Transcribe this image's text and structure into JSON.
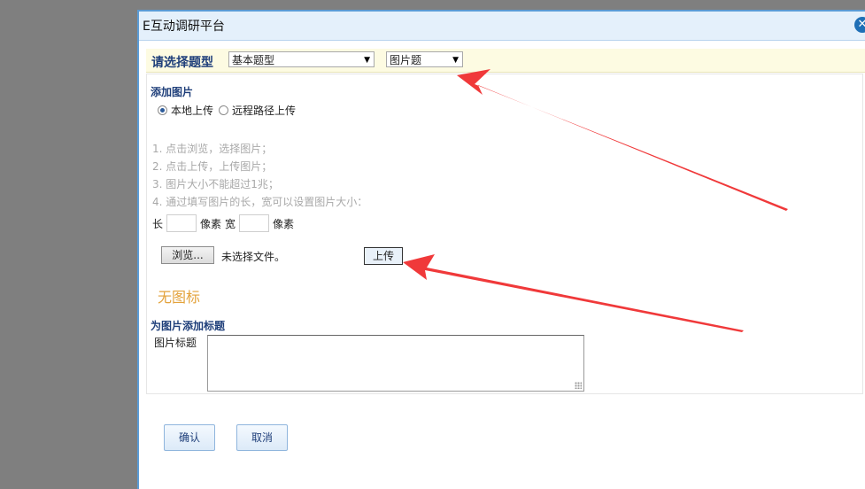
{
  "dialog": {
    "title": "E互动调研平台",
    "close_glyph": "✕"
  },
  "type_bar": {
    "label": "请选择题型",
    "category_select": "基本题型",
    "type_select": "图片题"
  },
  "add_image": {
    "heading": "添加图片",
    "radio_local": "本地上传",
    "radio_remote": "远程路径上传",
    "instructions": [
      "1. 点击浏览，选择图片；",
      "2. 点击上传，上传图片；",
      "3. 图片大小不能超过1兆；",
      "4. 通过填写图片的长，宽可以设置图片大小："
    ],
    "length_label": "长",
    "length_unit": "像素",
    "width_label": "宽",
    "width_unit": "像素",
    "browse_label": "浏览...",
    "no_file_text": "未选择文件。",
    "upload_label": "上传",
    "no_icon_text": "无图标"
  },
  "caption": {
    "heading": "为图片添加标题",
    "label": "图片标题"
  },
  "footer": {
    "confirm_label": "确认",
    "cancel_label": "取消"
  },
  "annotation_colors": {
    "arrow": "#f0393a"
  }
}
